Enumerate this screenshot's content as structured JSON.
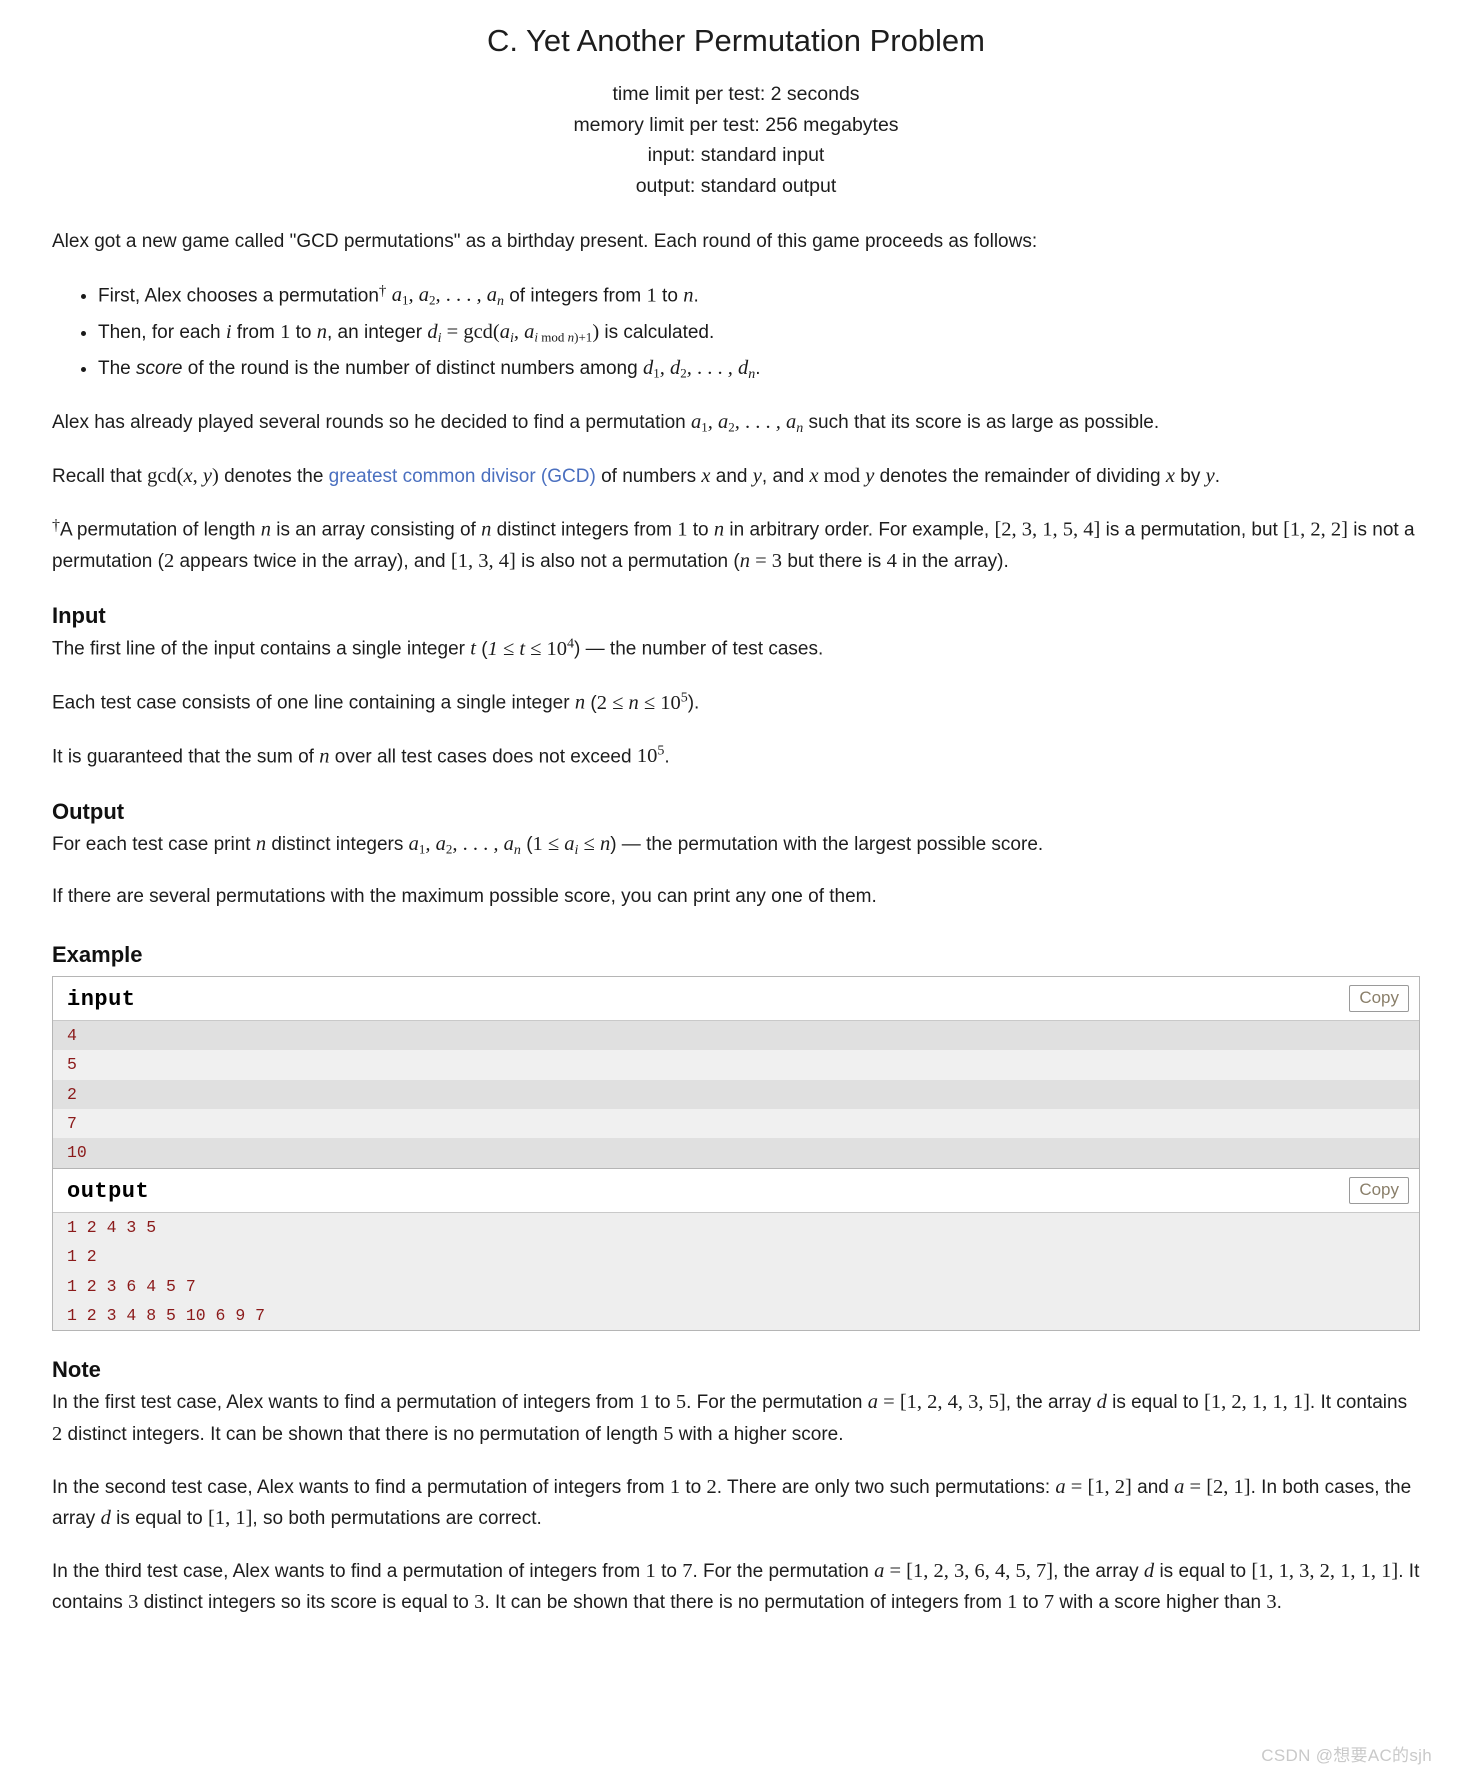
{
  "header": {
    "title": "C. Yet Another Permutation Problem",
    "time_limit": "time limit per test: 2 seconds",
    "memory_limit": "memory limit per test: 256 megabytes",
    "input_source": "input: standard input",
    "output_source": "output: standard output"
  },
  "statement": {
    "intro": "Alex got a new game called \"GCD permutations\" as a birthday present. Each round of this game proceeds as follows:",
    "bullet1_a": "First, Alex chooses a permutation",
    "bullet1_b": "of integers from",
    "bullet1_to": "to",
    "bullet1_end": ".",
    "bullet2_a": "Then, for each",
    "bullet2_b": "from",
    "bullet2_c": "to",
    "bullet2_d": ", an integer",
    "bullet2_e": "is calculated.",
    "bullet3_a": "The",
    "bullet3_score": "score",
    "bullet3_b": "of the round is the number of distinct numbers among",
    "bullet3_end": ".",
    "para_goal_a": "Alex has already played several rounds so he decided to find a permutation",
    "para_goal_b": "such that its score is as large as possible.",
    "recall_a": "Recall that",
    "recall_link": "greatest common divisor (GCD)",
    "recall_b": "denotes the",
    "recall_c": "of numbers",
    "recall_and": "and",
    "recall_d": ", and",
    "recall_e": "denotes the remainder of dividing",
    "recall_f": "by",
    "recall_end": ".",
    "footnote_a": "A permutation of length",
    "footnote_b": "is an array consisting of",
    "footnote_c": "distinct integers from",
    "footnote_d": "to",
    "footnote_e": "in arbitrary order. For example,",
    "footnote_f": "is a permutation, but",
    "footnote_g": "is not a permutation (",
    "footnote_h": "appears twice in the array), and",
    "footnote_i": "is also not a permutation (",
    "footnote_j": "but there is",
    "footnote_k": "in the array)."
  },
  "input_section": {
    "heading": "Input",
    "line1_a": "The first line of the input contains a single integer",
    "line1_b": ") — the number of test cases.",
    "line2_a": "Each test case consists of one line containing a single integer",
    "line2_b": ").",
    "line3_a": "It is guaranteed that the sum of",
    "line3_b": "over all test cases does not exceed",
    "line3_end": "."
  },
  "output_section": {
    "heading": "Output",
    "line1_a": "For each test case print",
    "line1_b": "distinct integers",
    "line1_c": ") — the permutation with the largest possible score.",
    "line2": "If there are several permutations with the maximum possible score, you can print any one of them."
  },
  "example": {
    "heading": "Example",
    "input_label": "input",
    "output_label": "output",
    "copy_label": "Copy",
    "input_lines": [
      "4",
      "5",
      "2",
      "7",
      "10"
    ],
    "output_lines": [
      "1 2 4 3 5",
      "1 2",
      "1 2 3 6 4 5 7",
      "1 2 3 4 8 5 10 6 9 7"
    ]
  },
  "note_section": {
    "heading": "Note",
    "p1_a": "In the first test case, Alex wants to find a permutation of integers from",
    "p1_b": "to",
    "p1_c": ". For the permutation",
    "p1_d": ", the array",
    "p1_e": "is equal to",
    "p1_f": ". It contains",
    "p1_g": "distinct integers. It can be shown that there is no permutation of length",
    "p1_h": "with a higher score.",
    "p2_a": "In the second test case, Alex wants to find a permutation of integers from",
    "p2_b": "to",
    "p2_c": ". There are only two such permutations:",
    "p2_and": "and",
    "p2_d": ". In both cases, the array",
    "p2_e": "is equal to",
    "p2_f": ", so both permutations are correct.",
    "p3_a": "In the third test case, Alex wants to find a permutation of integers from",
    "p3_b": "to",
    "p3_c": ". For the permutation",
    "p3_d": ", the array",
    "p3_e": "is equal to",
    "p3_f": ". It contains",
    "p3_g": "distinct integers so its score is equal to",
    "p3_h": ". It can be shown that there is no permutation of integers from",
    "p3_i": "to",
    "p3_j": "with a score higher than",
    "p3_k": "."
  },
  "watermark": "CSDN @想要AC的sjh",
  "colors": {
    "link": "#4a6fbf",
    "code_text": "#8b1a1a",
    "stripe_dark": "#e0e0e0",
    "stripe_light": "#f0f0f0",
    "border": "#b5b5b5"
  }
}
